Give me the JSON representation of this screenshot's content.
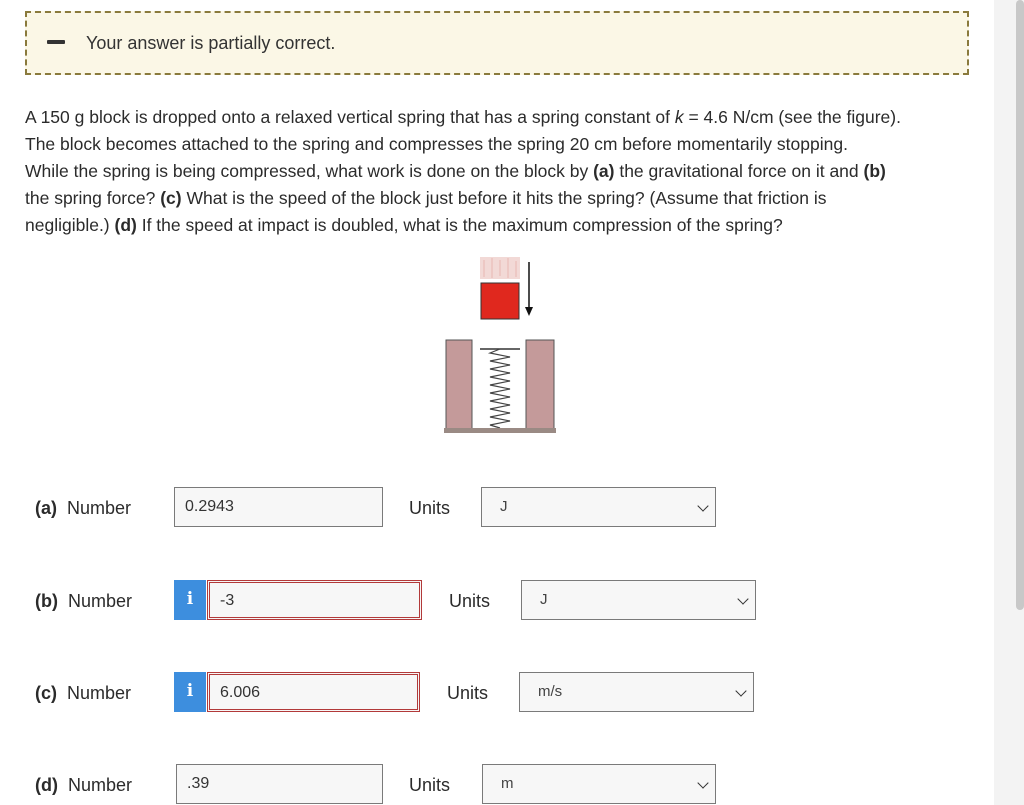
{
  "feedback": {
    "status_text": "Your answer is partially correct.",
    "status_icon": "minus-icon"
  },
  "question": {
    "line1": "A 150 g block is dropped onto a relaxed vertical spring that has a spring constant of ",
    "k_var": "k",
    "line1b": " = 4.6 N/cm (see the figure).",
    "line2": "The block becomes attached to the spring and compresses the spring 20 cm before momentarily stopping.",
    "line3a": "While the spring is being compressed, what work is done on the block by ",
    "part_a": "(a)",
    "line3b": " the gravitational force on it and ",
    "part_b": "(b)",
    "line4a": "the spring force? ",
    "part_c": "(c)",
    "line4b": " What is the speed of the block just before it hits the spring? (Assume that friction is",
    "line5a": "negligible.) ",
    "part_d": "(d)",
    "line5b": " If the speed at impact is doubled, what is the maximum compression of the spring?"
  },
  "answers": [
    {
      "part": "(a)",
      "number_label": "Number",
      "value": "0.2943",
      "status": "correct",
      "units_label": "Units",
      "unit": "J"
    },
    {
      "part": "(b)",
      "number_label": "Number",
      "value": "-3",
      "status": "wrong",
      "units_label": "Units",
      "unit": "J"
    },
    {
      "part": "(c)",
      "number_label": "Number",
      "value": "6.006",
      "status": "wrong",
      "units_label": "Units",
      "unit": "m/s"
    },
    {
      "part": "(d)",
      "number_label": "Number",
      "value": ".39",
      "status": "correct",
      "units_label": "Units",
      "unit": "m"
    }
  ],
  "info_icon_glyph": "i",
  "colors": {
    "feedback_bg": "#fbf7e6",
    "feedback_border": "#8a7a3c",
    "info_button": "#3d8ede",
    "wrong_border": "#b23a3a",
    "block": "#e0281e",
    "walls": "#c49a9a"
  }
}
